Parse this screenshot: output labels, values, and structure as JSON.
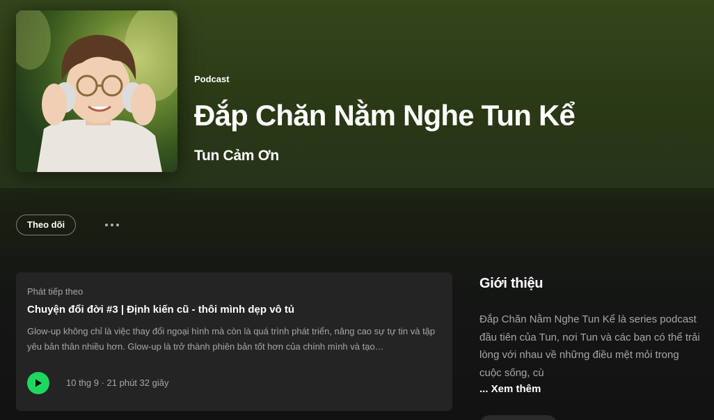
{
  "hero": {
    "type_label": "Podcast",
    "title": "Đắp Chăn Nằm Nghe Tun Kể",
    "author": "Tun Cảm Ơn"
  },
  "actions": {
    "follow_label": "Theo dõi",
    "more_icon": "more-dots-icon"
  },
  "episode": {
    "section_label": "Phát tiếp theo",
    "title": "Chuyện đổi đời #3 | Định kiến cũ - thôi mình dẹp vô tủ",
    "description": "Glow-up không chỉ là việc thay đổi ngoại hình mà còn là quá trình phát triển, nâng cao sự tự tin và tập yêu bản thân nhiều hơn. Glow-up là trở thành phiên bản tốt hơn của chính mình và tạo…",
    "meta": "10 thg 9 · 21 phút 32 giây",
    "play_icon": "play-icon"
  },
  "about": {
    "title": "Giới thiệu",
    "text": "Đắp Chăn Nằm Nghe Tun Kể là series podcast đầu tiên của Tun, nơi Tun và các bạn có thể trải lòng với nhau về những điều mệt mỏi trong cuộc sống, cù",
    "see_more": "... Xem thêm"
  },
  "colors": {
    "accent_green": "#1ed760",
    "hero_bg": "#35461b",
    "card_bg": "#242424",
    "subtext": "#a7a7a7"
  }
}
